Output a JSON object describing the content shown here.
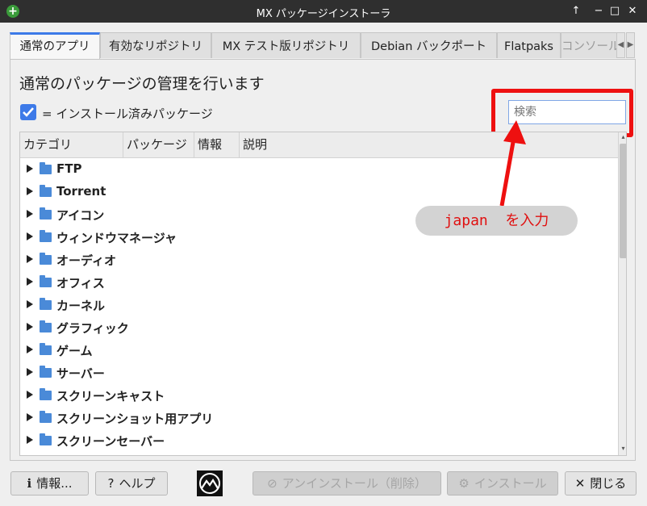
{
  "window": {
    "title": "MX パッケージインストーラ",
    "controls": [
      "↑",
      "−",
      "□",
      "✕"
    ]
  },
  "tabs": [
    {
      "label": "通常のアプリ"
    },
    {
      "label": "有効なリポジトリ"
    },
    {
      "label": "MX テスト版リポジトリ"
    },
    {
      "label": "Debian バックポート"
    },
    {
      "label": "Flatpaks"
    },
    {
      "label": "コンソール"
    }
  ],
  "tab_scroll": {
    "left": "◀",
    "right": "▶"
  },
  "main": {
    "heading": "通常のパッケージの管理を行います",
    "checkbox_label": "= インストール済みパッケージ",
    "checkbox_checked": true,
    "search_placeholder": "検索"
  },
  "tree": {
    "columns": [
      "カテゴリ",
      "パッケージ",
      "情報",
      "説明"
    ],
    "rows": [
      {
        "label": "FTP"
      },
      {
        "label": "Torrent"
      },
      {
        "label": "アイコン"
      },
      {
        "label": "ウィンドウマネージャ"
      },
      {
        "label": "オーディオ"
      },
      {
        "label": "オフィス"
      },
      {
        "label": "カーネル"
      },
      {
        "label": "グラフィック"
      },
      {
        "label": "ゲーム"
      },
      {
        "label": "サーバー"
      },
      {
        "label": "スクリーンキャスト"
      },
      {
        "label": "スクリーンショット用アプリ"
      },
      {
        "label": "スクリーンセーバー"
      }
    ]
  },
  "annotation": {
    "text": "japan  を入力",
    "color": "#e01010"
  },
  "buttons": {
    "info": "情報...",
    "help": "ヘルプ",
    "uninstall": "アンインストール（削除）",
    "install": "インストール",
    "close": "閉じる"
  },
  "colors": {
    "accent": "#3d7ae8",
    "highlight": "#ee1010",
    "titlebar": "#2f2f2f"
  }
}
